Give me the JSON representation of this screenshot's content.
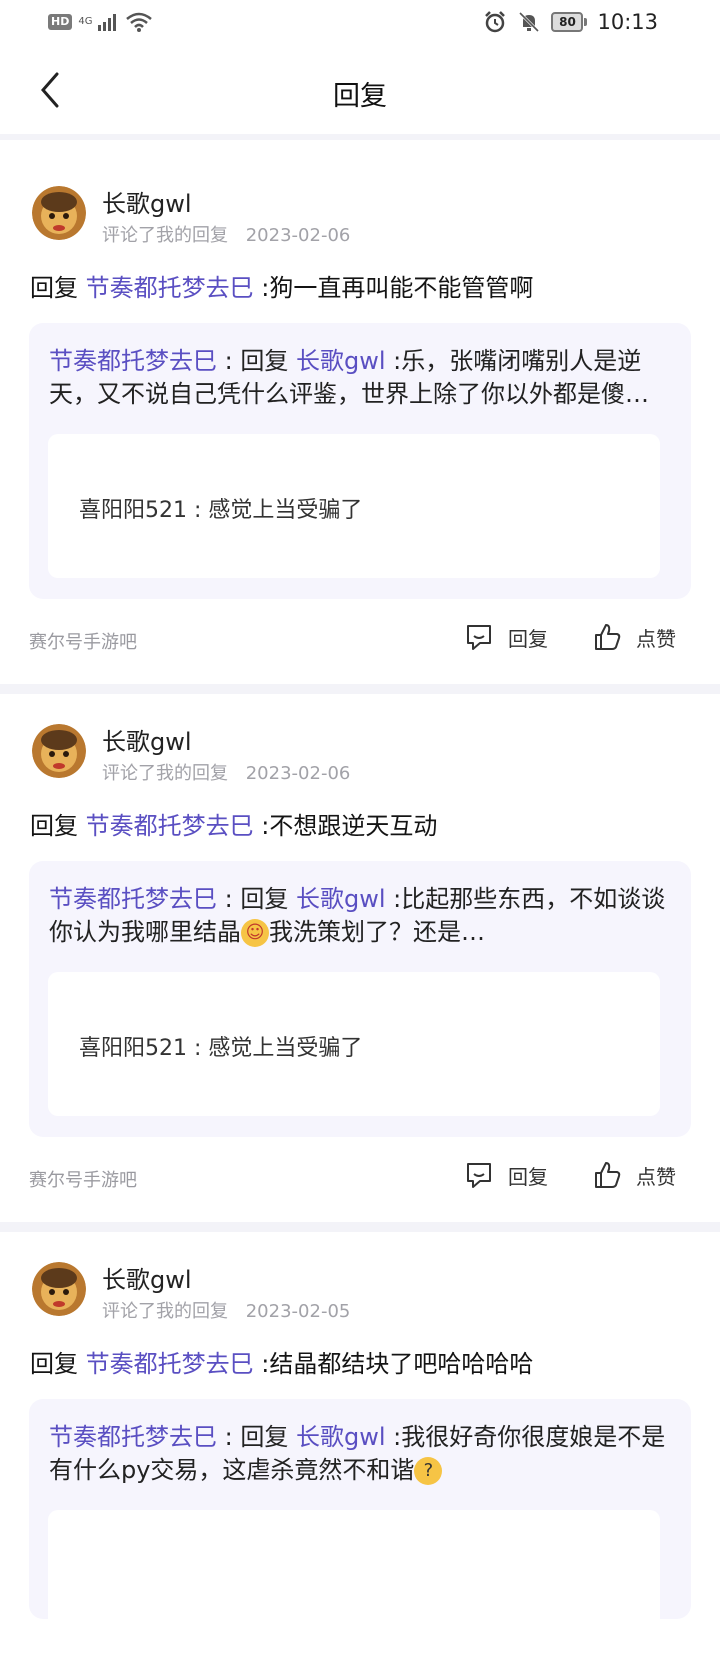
{
  "status_bar": {
    "hd": "HD",
    "network": "4G",
    "battery": "80",
    "time": "10:13"
  },
  "header": {
    "title": "回复"
  },
  "items": [
    {
      "username": "长歌gwl",
      "action_text": "评论了我的回复",
      "date": "2023-02-06",
      "reply_prefix": "回复",
      "reply_target": "节奏都托梦去巳",
      "reply_text": ":狗一直再叫能不能管管啊",
      "quote_author": "节奏都托梦去巳",
      "quote_sep": " : 回复 ",
      "quote_target": "长歌gwl",
      "quote_text": " :乐，张嘴闭嘴别人是逆天，又不说自己凭什么评鉴，世界上除了你以外都是傻逼…",
      "inner_text": "喜阳阳521 : 感觉上当受骗了",
      "forum": "赛尔号手游吧",
      "reply_label": "回复",
      "like_label": "点赞"
    },
    {
      "username": "长歌gwl",
      "action_text": "评论了我的回复",
      "date": "2023-02-06",
      "reply_prefix": "回复",
      "reply_target": "节奏都托梦去巳",
      "reply_text": ":不想跟逆天互动",
      "quote_author": "节奏都托梦去巳",
      "quote_sep": " : 回复 ",
      "quote_target": "长歌gwl",
      "quote_text_a": " :比起那些东西，不如谈谈你认为我哪里结晶",
      "quote_text_b": "我洗策划了？还是…",
      "inner_text": "喜阳阳521 : 感觉上当受骗了",
      "forum": "赛尔号手游吧",
      "reply_label": "回复",
      "like_label": "点赞"
    },
    {
      "username": "长歌gwl",
      "action_text": "评论了我的回复",
      "date": "2023-02-05",
      "reply_prefix": "回复",
      "reply_target": "节奏都托梦去巳",
      "reply_text": ":结晶都结块了吧哈哈哈哈",
      "quote_author": "节奏都托梦去巳",
      "quote_sep": " : 回复 ",
      "quote_target": "长歌gwl",
      "quote_text": " :我很好奇你很度娘是不是有什么py交易，这虐杀竟然不和谐"
    }
  ]
}
